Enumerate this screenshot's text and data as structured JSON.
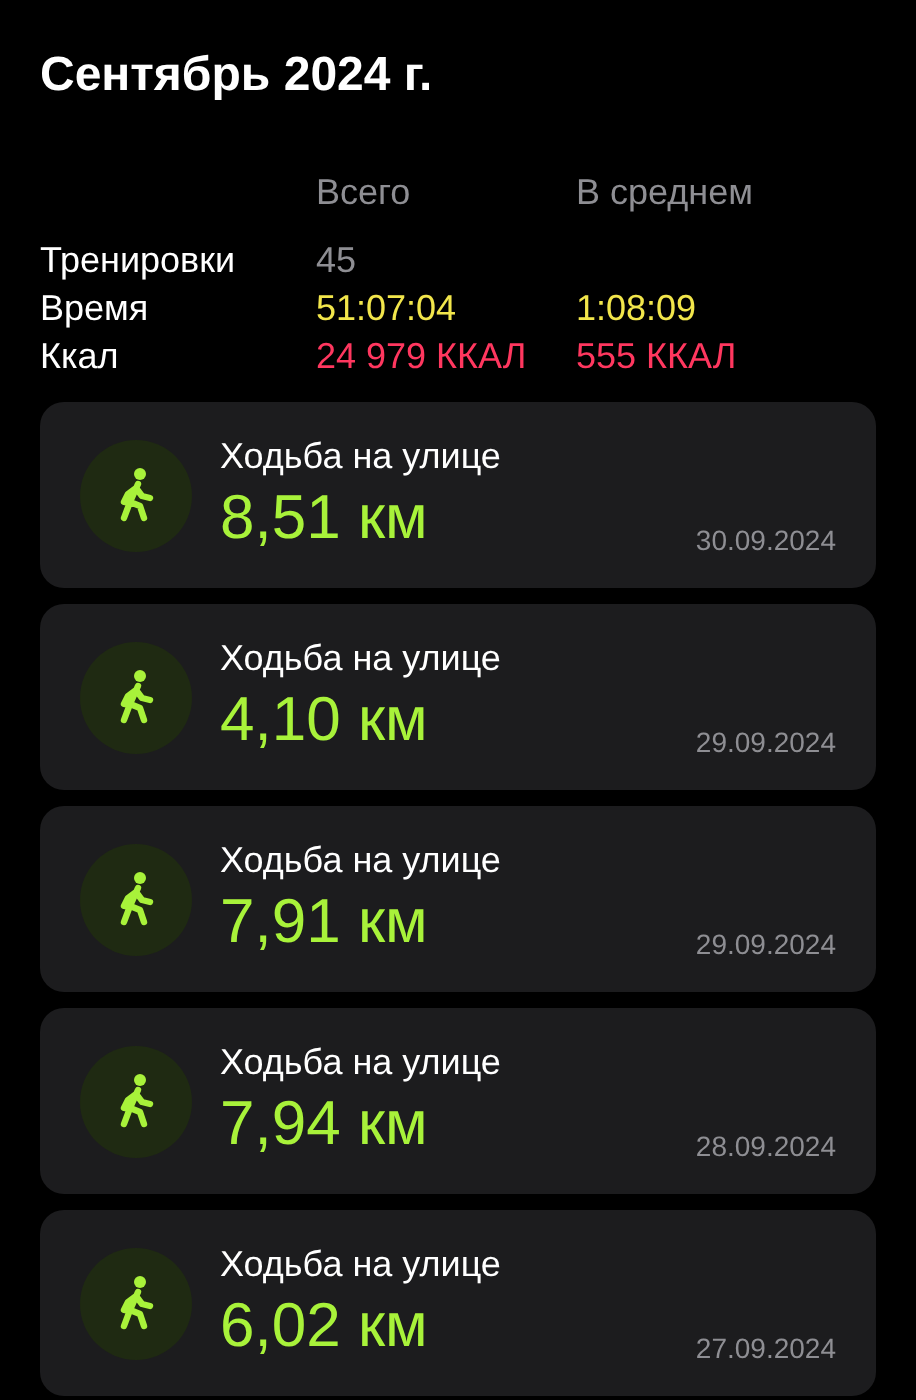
{
  "title": "Сентябрь 2024 г.",
  "summary": {
    "columns": [
      "Всего",
      "В среднем"
    ],
    "rows": [
      {
        "label": "Тренировки",
        "kind": "count",
        "values": [
          "45"
        ]
      },
      {
        "label": "Время",
        "kind": "time",
        "values": [
          "51:07:04",
          "1:08:09"
        ]
      },
      {
        "label": "Ккал",
        "kind": "energy",
        "values": [
          "24 979 ККАЛ",
          "555 ККАЛ"
        ]
      }
    ]
  },
  "workouts": [
    {
      "name": "Ходьба на улице",
      "distance": "8,51 км",
      "date": "30.09.2024"
    },
    {
      "name": "Ходьба на улице",
      "distance": "4,10 км",
      "date": "29.09.2024"
    },
    {
      "name": "Ходьба на улице",
      "distance": "7,91 км",
      "date": "29.09.2024"
    },
    {
      "name": "Ходьба на улице",
      "distance": "7,94 км",
      "date": "28.09.2024"
    },
    {
      "name": "Ходьба на улице",
      "distance": "6,02 км",
      "date": "27.09.2024"
    }
  ]
}
